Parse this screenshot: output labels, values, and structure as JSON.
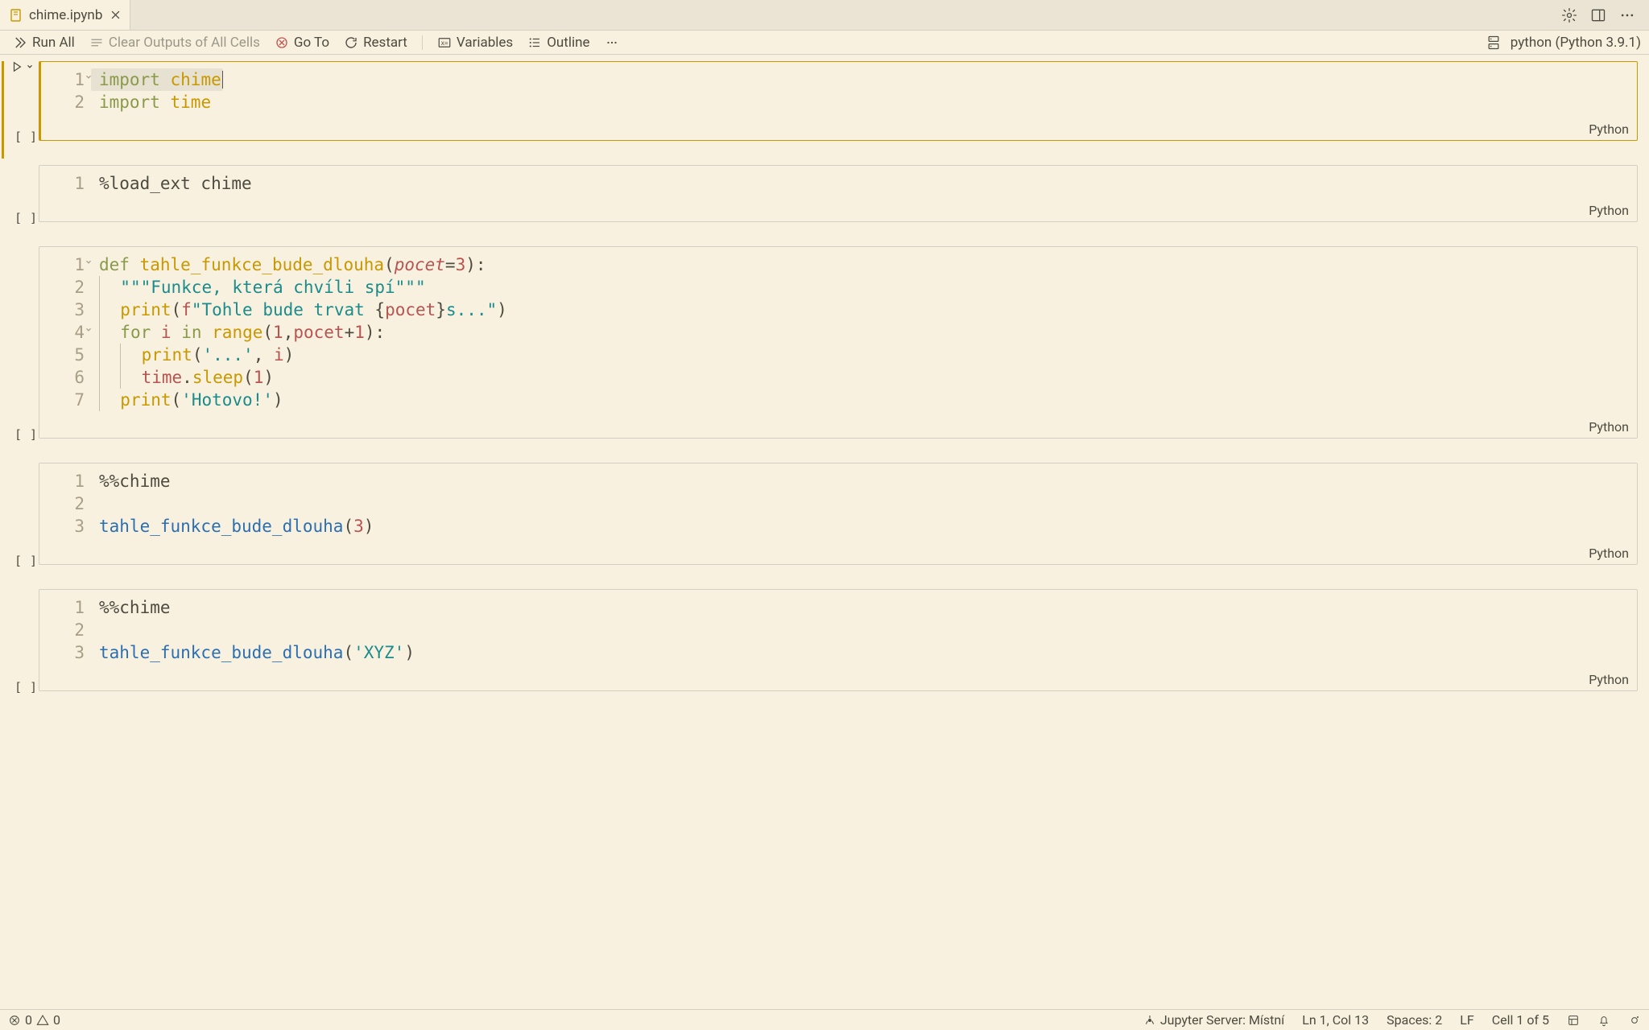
{
  "tab": {
    "title": "chime.ipynb"
  },
  "toolbar": {
    "run_all": "Run All",
    "clear_outputs": "Clear Outputs of All Cells",
    "go_to": "Go To",
    "restart": "Restart",
    "variables": "Variables",
    "outline": "Outline"
  },
  "kernel": {
    "label": "python (Python 3.9.1)"
  },
  "cells": [
    {
      "exec": "[ ]",
      "lang": "Python",
      "active": true,
      "lines": [
        {
          "no": "1",
          "fold": true,
          "tokens": [
            [
              "kw",
              "import"
            ],
            [
              "sp",
              " "
            ],
            [
              "mod",
              "chime"
            ]
          ],
          "active": true,
          "cursor_after": true
        },
        {
          "no": "2",
          "tokens": [
            [
              "kw",
              "import"
            ],
            [
              "sp",
              " "
            ],
            [
              "mod",
              "time"
            ]
          ]
        }
      ]
    },
    {
      "exec": "[ ]",
      "lang": "Python",
      "lines": [
        {
          "no": "1",
          "tokens": [
            [
              "magic",
              "%load_ext chime"
            ]
          ]
        }
      ]
    },
    {
      "exec": "[ ]",
      "lang": "Python",
      "lines": [
        {
          "no": "1",
          "fold": true,
          "tokens": [
            [
              "kw",
              "def"
            ],
            [
              "sp",
              " "
            ],
            [
              "def",
              "tahle_funkce_bude_dlouha"
            ],
            [
              "op",
              "("
            ],
            [
              "param",
              "pocet"
            ],
            [
              "op",
              "="
            ],
            [
              "num",
              "3"
            ],
            [
              "op",
              "):"
            ]
          ]
        },
        {
          "no": "2",
          "indent": 1,
          "tokens": [
            [
              "str",
              "\"\"\"Funkce, která chvíli spí\"\"\""
            ]
          ]
        },
        {
          "no": "3",
          "indent": 1,
          "tokens": [
            [
              "builtin",
              "print"
            ],
            [
              "op",
              "("
            ],
            [
              "fstr",
              "f"
            ],
            [
              "str",
              "\"Tohle bude trvat "
            ],
            [
              "op",
              "{"
            ],
            [
              "var",
              "pocet"
            ],
            [
              "op",
              "}"
            ],
            [
              "str",
              "s...\""
            ],
            [
              "op",
              ")"
            ]
          ]
        },
        {
          "no": "4",
          "fold": true,
          "indent": 1,
          "tokens": [
            [
              "kw",
              "for"
            ],
            [
              "sp",
              " "
            ],
            [
              "var",
              "i"
            ],
            [
              "sp",
              " "
            ],
            [
              "kw",
              "in"
            ],
            [
              "sp",
              " "
            ],
            [
              "builtin",
              "range"
            ],
            [
              "op",
              "("
            ],
            [
              "num",
              "1"
            ],
            [
              "op",
              ","
            ],
            [
              "var",
              "pocet"
            ],
            [
              "op",
              "+"
            ],
            [
              "num",
              "1"
            ],
            [
              "op",
              "):"
            ]
          ]
        },
        {
          "no": "5",
          "indent": 2,
          "tokens": [
            [
              "builtin",
              "print"
            ],
            [
              "op",
              "("
            ],
            [
              "str",
              "'...'"
            ],
            [
              "op",
              ", "
            ],
            [
              "var",
              "i"
            ],
            [
              "op",
              ")"
            ]
          ]
        },
        {
          "no": "6",
          "indent": 2,
          "tokens": [
            [
              "var",
              "time"
            ],
            [
              "op",
              "."
            ],
            [
              "method",
              "sleep"
            ],
            [
              "op",
              "("
            ],
            [
              "num",
              "1"
            ],
            [
              "op",
              ")"
            ]
          ]
        },
        {
          "no": "7",
          "indent": 1,
          "tokens": [
            [
              "builtin",
              "print"
            ],
            [
              "op",
              "("
            ],
            [
              "str",
              "'Hotovo!'"
            ],
            [
              "op",
              ")"
            ]
          ]
        }
      ]
    },
    {
      "exec": "[ ]",
      "lang": "Python",
      "lines": [
        {
          "no": "1",
          "tokens": [
            [
              "magic",
              "%%chime"
            ]
          ]
        },
        {
          "no": "2",
          "tokens": []
        },
        {
          "no": "3",
          "tokens": [
            [
              "fn",
              "tahle_funkce_bude_dlouha"
            ],
            [
              "op",
              "("
            ],
            [
              "num",
              "3"
            ],
            [
              "op",
              ")"
            ]
          ]
        }
      ]
    },
    {
      "exec": "[ ]",
      "lang": "Python",
      "lines": [
        {
          "no": "1",
          "tokens": [
            [
              "magic",
              "%%chime"
            ]
          ]
        },
        {
          "no": "2",
          "tokens": []
        },
        {
          "no": "3",
          "tokens": [
            [
              "fn",
              "tahle_funkce_bude_dlouha"
            ],
            [
              "op",
              "("
            ],
            [
              "str",
              "'XYZ'"
            ],
            [
              "op",
              ")"
            ]
          ]
        }
      ]
    }
  ],
  "status": {
    "errors": "0",
    "warnings": "0",
    "jupyter_label": "Jupyter Server: Místní",
    "cursor": "Ln 1, Col 13",
    "spaces": "Spaces: 2",
    "eol": "LF",
    "cell": "Cell 1 of 5"
  }
}
